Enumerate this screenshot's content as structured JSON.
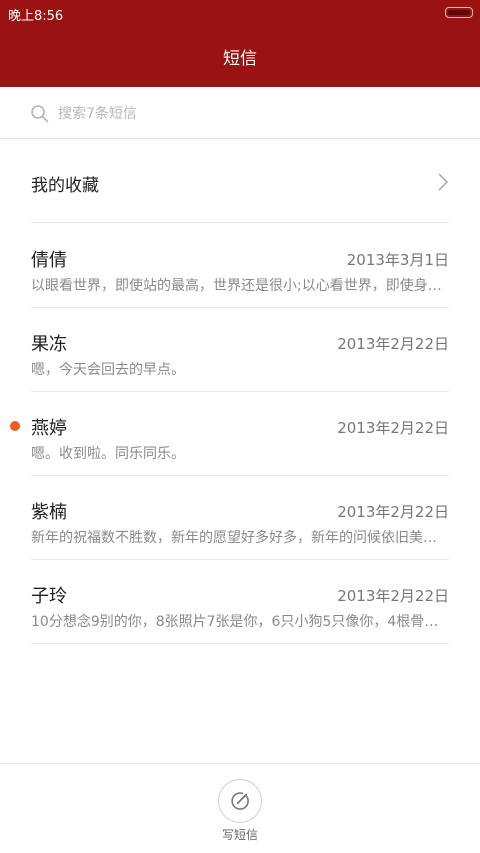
{
  "status_bar": {
    "time": "晚上8:56"
  },
  "header": {
    "title": "短信"
  },
  "search": {
    "placeholder": "搜索7条短信"
  },
  "favorites": {
    "label": "我的收藏"
  },
  "conversations": [
    {
      "name": "倩倩",
      "date": "2013年3月1日",
      "preview": "以眼看世界，即使站的最高，世界还是很小;以心看世界，即使身…",
      "unread": false
    },
    {
      "name": "果冻",
      "date": "2013年2月22日",
      "preview": "嗯，今天会回去的早点。",
      "unread": false
    },
    {
      "name": "燕婷",
      "date": "2013年2月22日",
      "preview": "嗯。收到啦。同乐同乐。",
      "unread": true
    },
    {
      "name": "紫楠",
      "date": "2013年2月22日",
      "preview": "新年的祝福数不胜数，新年的愿望好多好多，新年的问候依旧美…",
      "unread": false
    },
    {
      "name": "子玲",
      "date": "2013年2月22日",
      "preview": "10分想念9别的你，8张照片7张是你，6只小狗5只像你，4根骨…",
      "unread": false
    }
  ],
  "bottom_bar": {
    "compose_label": "写短信"
  },
  "colors": {
    "header": "#9b1212",
    "unread_dot": "#f05a23"
  }
}
